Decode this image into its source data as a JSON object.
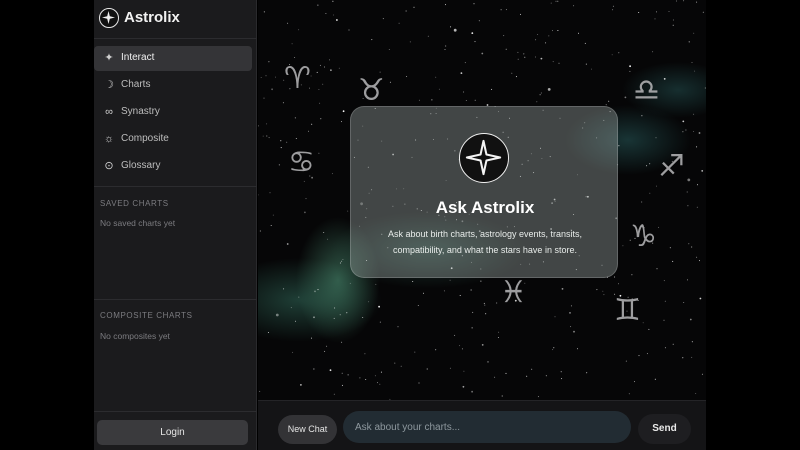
{
  "app": {
    "name": "Astrolix",
    "logo_icon": "north-star-icon"
  },
  "sidebar": {
    "nav": [
      {
        "label": "Interact",
        "icon": "sparkle-icon",
        "active": true
      },
      {
        "label": "Charts",
        "icon": "moon-icon",
        "active": false
      },
      {
        "label": "Synastry",
        "icon": "infinity-icon",
        "active": false
      },
      {
        "label": "Composite",
        "icon": "sun-icon",
        "active": false
      },
      {
        "label": "Glossary",
        "icon": "circle-dot-icon",
        "active": false
      }
    ],
    "saved_charts": {
      "title": "SAVED CHARTS",
      "empty_text": "No saved charts yet"
    },
    "composite_charts": {
      "title": "COMPOSITE CHARTS",
      "empty_text": "No composites yet"
    },
    "login_label": "Login"
  },
  "main": {
    "zodiac_symbols": [
      "♈",
      "♉",
      "♎",
      "♋",
      "♐",
      "♑",
      "♓",
      "♊"
    ],
    "welcome": {
      "title": "Ask Astrolix",
      "description": "Ask about birth charts, astrology events, transits, compatibility, and what the stars have in store."
    }
  },
  "composer": {
    "new_chat_label": "New Chat",
    "input_placeholder": "Ask about your charts...",
    "input_value": "",
    "send_label": "Send"
  },
  "colors": {
    "sidebar_bg": "#1b1b1d",
    "active_item_bg": "#343437",
    "input_bg": "#222c33",
    "nebula": "#4f9a80"
  }
}
